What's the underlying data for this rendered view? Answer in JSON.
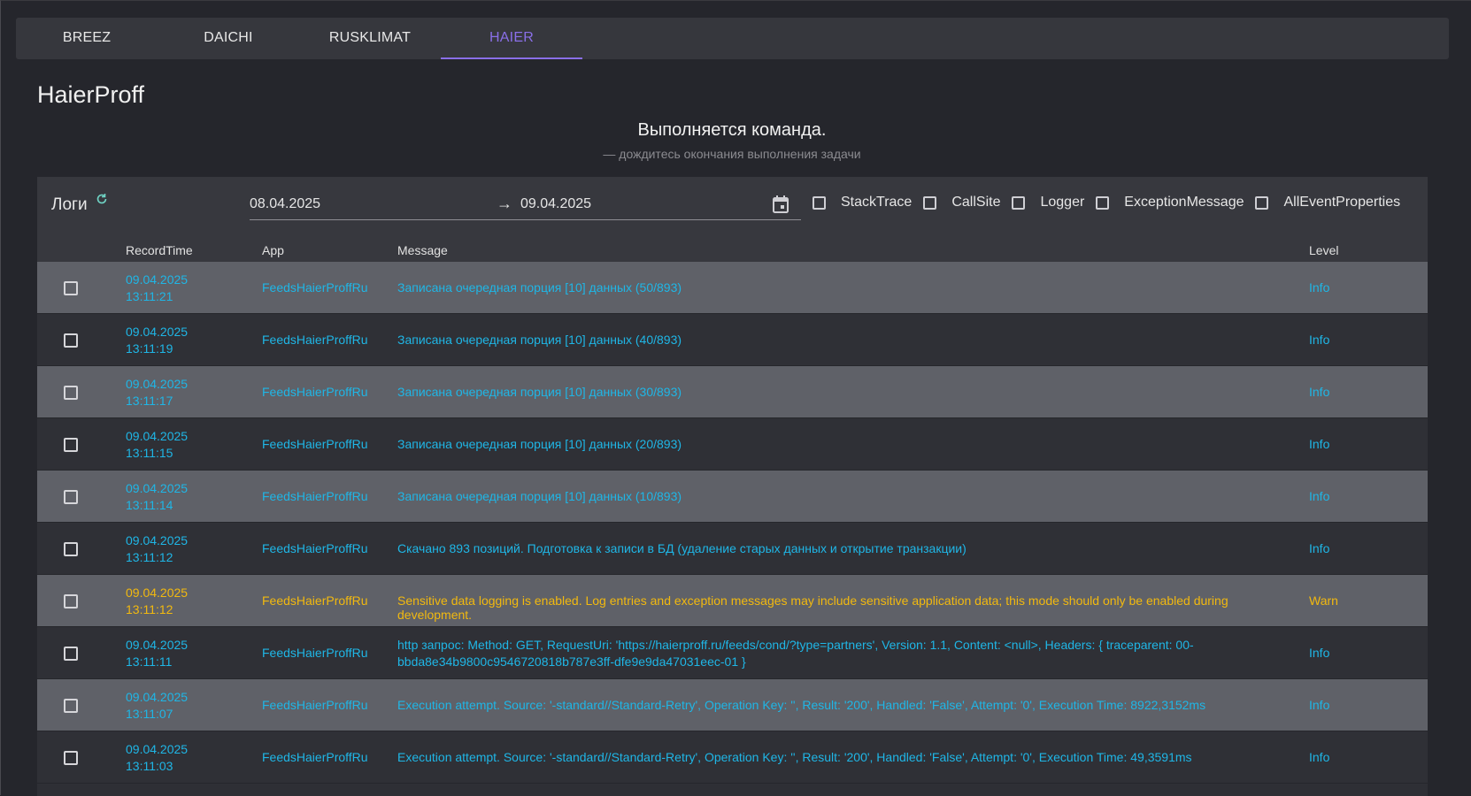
{
  "tabs": [
    {
      "label": "BREEZ",
      "active": false
    },
    {
      "label": "DAICHI",
      "active": false
    },
    {
      "label": "RUSKLIMAT",
      "active": false
    },
    {
      "label": "HAIER",
      "active": true
    }
  ],
  "app_title": "HaierProff",
  "command": {
    "title": "Выполняется команда.",
    "subtitle": "— дождитесь окончания выполнения задачи"
  },
  "logs": {
    "label": "Логи",
    "refresh_icon": "refresh-icon",
    "date_from": "08.04.2025",
    "date_arrow": "→",
    "date_to": "09.04.2025",
    "calendar_icon": "calendar-icon",
    "filters": [
      {
        "label": "StackTrace",
        "checked": false
      },
      {
        "label": "CallSite",
        "checked": false
      },
      {
        "label": "Logger",
        "checked": false
      },
      {
        "label": "ExceptionMessage",
        "checked": false
      },
      {
        "label": "AllEventProperties",
        "checked": false
      }
    ],
    "columns": {
      "time": "RecordTime",
      "app": "App",
      "message": "Message",
      "level": "Level"
    },
    "rows": [
      {
        "date": "09.04.2025",
        "time": "13:11:21",
        "app": "FeedsHaierProffRu",
        "message": "Записана очередная порция [10] данных (50/893)",
        "message2": "",
        "level": "Info"
      },
      {
        "date": "09.04.2025",
        "time": "13:11:19",
        "app": "FeedsHaierProffRu",
        "message": "Записана очередная порция [10] данных (40/893)",
        "message2": "",
        "level": "Info"
      },
      {
        "date": "09.04.2025",
        "time": "13:11:17",
        "app": "FeedsHaierProffRu",
        "message": "Записана очередная порция [10] данных (30/893)",
        "message2": "",
        "level": "Info"
      },
      {
        "date": "09.04.2025",
        "time": "13:11:15",
        "app": "FeedsHaierProffRu",
        "message": "Записана очередная порция [10] данных (20/893)",
        "message2": "",
        "level": "Info"
      },
      {
        "date": "09.04.2025",
        "time": "13:11:14",
        "app": "FeedsHaierProffRu",
        "message": "Записана очередная порция [10] данных (10/893)",
        "message2": "",
        "level": "Info"
      },
      {
        "date": "09.04.2025",
        "time": "13:11:12",
        "app": "FeedsHaierProffRu",
        "message": "Скачано 893 позиций. Подготовка к записи в БД (удаление старых данных и открытие транзакции)",
        "message2": "",
        "level": "Info"
      },
      {
        "date": "09.04.2025",
        "time": "13:11:12",
        "app": "FeedsHaierProffRu",
        "message": "Sensitive data logging is enabled. Log entries and exception messages may include sensitive application data; this mode should only be enabled during development.",
        "message2": "",
        "level": "Warn"
      },
      {
        "date": "09.04.2025",
        "time": "13:11:11",
        "app": "FeedsHaierProffRu",
        "message": "http запрос: Method: GET, RequestUri: 'https://haierproff.ru/feeds/cond/?type=partners', Version: 1.1, Content: <null>, Headers: { traceparent: 00-",
        "message2": "bbda8e34b9800c9546720818b787e3ff-dfe9e9da47031eec-01 }",
        "level": "Info"
      },
      {
        "date": "09.04.2025",
        "time": "13:11:07",
        "app": "FeedsHaierProffRu",
        "message": "Execution attempt. Source: '-standard//Standard-Retry', Operation Key: '', Result: '200', Handled: 'False', Attempt: '0', Execution Time: 8922,3152ms",
        "message2": "",
        "level": "Info"
      },
      {
        "date": "09.04.2025",
        "time": "13:11:03",
        "app": "FeedsHaierProffRu",
        "message": "Execution attempt. Source: '-standard//Standard-Retry', Operation Key: '', Result: '200', Handled: 'False', Attempt: '0', Execution Time: 49,3591ms",
        "message2": "",
        "level": "Info"
      }
    ]
  }
}
